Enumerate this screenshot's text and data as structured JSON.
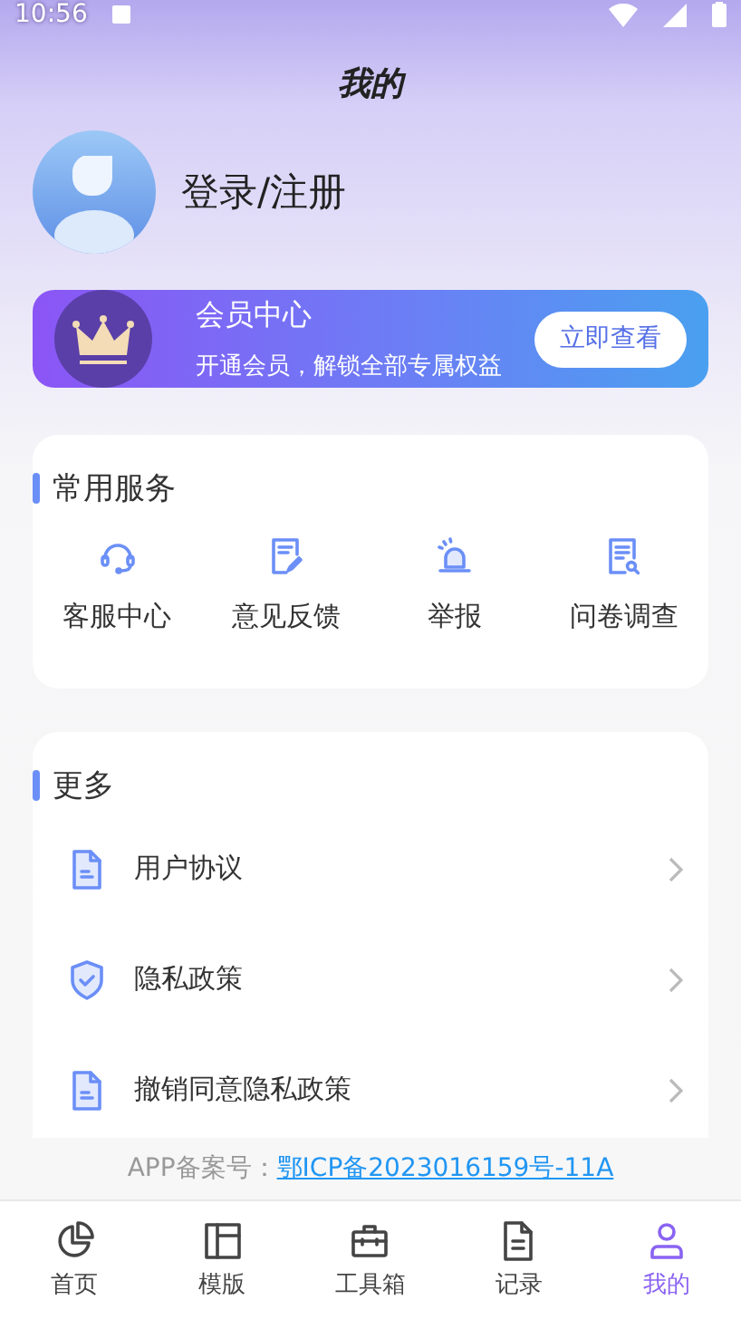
{
  "status_bar": {
    "time": "10:56"
  },
  "header": {
    "title": "我的"
  },
  "profile": {
    "login_label": "登录/注册"
  },
  "member_card": {
    "title": "会员中心",
    "subtitle": "开通会员，解锁全部专属权益",
    "button": "立即查看"
  },
  "services": {
    "title": "常用服务",
    "items": [
      {
        "label": "客服中心",
        "kind": "headset"
      },
      {
        "label": "意见反馈",
        "kind": "edit"
      },
      {
        "label": "举报",
        "kind": "alarm"
      },
      {
        "label": "问卷调查",
        "kind": "survey"
      }
    ]
  },
  "more": {
    "title": "更多",
    "items": [
      {
        "label": "用户协议",
        "kind": "document"
      },
      {
        "label": "隐私政策",
        "kind": "shield"
      },
      {
        "label": "撤销同意隐私政策",
        "kind": "document"
      }
    ]
  },
  "icp": {
    "label": "APP备案号：",
    "link": "鄂ICP备2023016159号-11A"
  },
  "tabs": [
    {
      "label": "首页",
      "kind": "chart",
      "selected": false
    },
    {
      "label": "模版",
      "kind": "layout",
      "selected": false
    },
    {
      "label": "工具箱",
      "kind": "toolbox",
      "selected": false
    },
    {
      "label": "记录",
      "kind": "file",
      "selected": false
    },
    {
      "label": "我的",
      "kind": "user",
      "selected": true
    }
  ]
}
